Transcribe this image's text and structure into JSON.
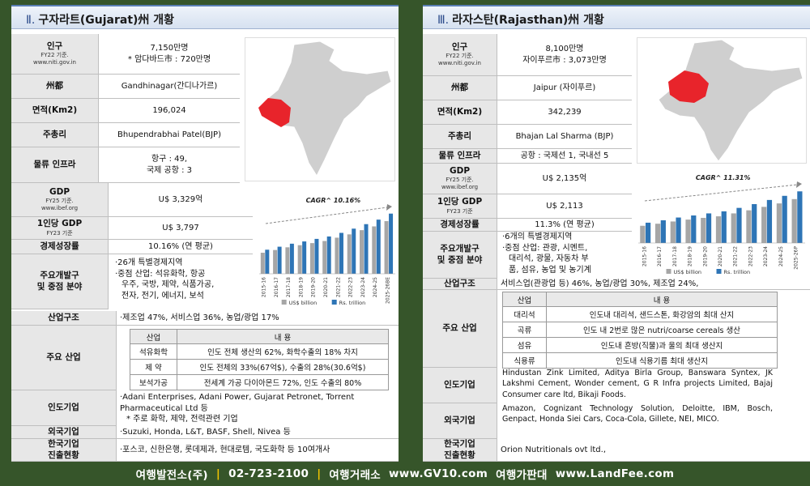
{
  "footer": {
    "company": "여행발전소(주)",
    "phone": "02-723-2100",
    "agency": "여행거래소",
    "site1": "www.GV10.com",
    "market": "여행가판대",
    "site2": "www.LandFee.com"
  },
  "gujarat": {
    "roman": "Ⅱ.",
    "title": "구자라트(Gujarat)州 개황",
    "population": {
      "label": "인구",
      "sub1": "FY22 기준.",
      "sub2": "www.niti.gov.in",
      "line1": "7,150만명",
      "line2": "* 암다바드市 : 720만명"
    },
    "capital": {
      "label": "州都",
      "value": "Gandhinagar(간디나가르)"
    },
    "area": {
      "label": "면적(Km2)",
      "value": "196,024"
    },
    "cm": {
      "label": "주총리",
      "value": "Bhupendrabhai Patel(BJP)"
    },
    "logistics": {
      "label": "물류 인프라",
      "line1": "항구 : 49,",
      "line2": "국제 공항 : 3"
    },
    "gdp": {
      "label": "GDP",
      "sub1": "FY25 기준.",
      "sub2": "www.ibef.org",
      "value": "U$ 3,329억"
    },
    "gdppc": {
      "label": "1인당 GDP",
      "sub": "FY23 기준",
      "value": "U$ 3,797"
    },
    "growth": {
      "label": "경제성장률",
      "value": "10.16% (연 평균)"
    },
    "zones": {
      "label1": "주요개발구",
      "label2": "및 중점 분야",
      "lines": [
        "·26개 특별경제지역",
        "·중점 산업: 석유화학, 항공",
        "우주, 국방, 제약, 식품가공,",
        "전자, 전기, 에너지, 보석"
      ]
    },
    "structure": {
      "label": "산업구조",
      "value": "·제조업 47%, 서비스업 36%, 농업/광업 17%"
    },
    "industry": {
      "label": "주요 산업",
      "head1": "산업",
      "head2": "내 용",
      "rows": [
        {
          "name": "석유화학",
          "desc": "인도 전체 생산의 62%, 화학수출의 18% 차지"
        },
        {
          "name": "제 약",
          "desc": "인도 전체의 33%(67억$), 수출의 28%(30.6억$)"
        },
        {
          "name": "보석가공",
          "desc": "전세계 가공 다이아몬드 72%, 인도 수출의 80%"
        }
      ]
    },
    "indian": {
      "label": "인도기업",
      "line1": "·Adani Enterprises, Adani Power, Gujarat Petronet, Torrent Pharmaceutical Ltd 등",
      "line2": "* 주로 화학, 제약, 전력관련 기업"
    },
    "foreign": {
      "label": "외국기업",
      "value": "·Suzuki, Honda, L&T, BASF, Shell, Nivea 등"
    },
    "korean": {
      "label1": "한국기업",
      "label2": "진출현황",
      "value": "·포스코, 신한은행, 롯데제과, 현대로템, 국도화학 등 10여개사"
    }
  },
  "rajasthan": {
    "roman": "Ⅲ.",
    "title": "라자스탄(Rajasthan)州 개황",
    "population": {
      "label": "인구",
      "sub1": "FY22 기준.",
      "sub2": "www.niti.gov.in",
      "line1": "8,100만명",
      "line2": "자이푸르市 : 3,073만명"
    },
    "capital": {
      "label": "州都",
      "value": "Jaipur (자이푸르)"
    },
    "area": {
      "label": "면적(Km2)",
      "value": "342,239"
    },
    "cm": {
      "label": "주총리",
      "value": "Bhajan Lal Sharma (BJP)"
    },
    "logistics": {
      "label": "물류 인프라",
      "value": "공항 : 국제선 1, 국내선 5"
    },
    "gdp": {
      "label": "GDP",
      "sub1": "FY25 기준.",
      "sub2": "www.ibef.org",
      "value": "U$ 2,135억"
    },
    "gdppc": {
      "label": "1인당 GDP",
      "sub": "FY23 기준",
      "value": "U$ 2,113"
    },
    "growth": {
      "label": "경제성장률",
      "value": "11.3% (연 평균)"
    },
    "zones": {
      "label1": "주요개발구",
      "label2": "및 중점 분야",
      "lines": [
        "·6개의 특별경제지역",
        "·중점 산업: 관광, 시멘트,",
        "대리석, 광물, 자동차 부",
        "품, 섬유, 농업 및 농기계"
      ]
    },
    "structure": {
      "label": "산업구조",
      "value": "서비스업(관광업 등) 46%, 농업/광업 30%, 제조업 24%,"
    },
    "industry": {
      "label": "주요 산업",
      "head1": "산업",
      "head2": "내 용",
      "rows": [
        {
          "name": "대리석",
          "desc": "인도내 대리석, 샌드스톤, 화강암의 최대 산지"
        },
        {
          "name": "곡류",
          "desc": "인도 내 2번로 많은 nutri/coarse cereals 생산"
        },
        {
          "name": "섬유",
          "desc": "인도내 흔방(직물)과 울의 최대 생산지"
        },
        {
          "name": "식용류",
          "desc": "인도내 식용기름 최대 생산지"
        }
      ]
    },
    "indian": {
      "label": "인도기업",
      "value": "Hindustan Zink Limited, Aditya Birla Group, Banswara Syntex, JK Lakshmi Cement, Wonder cement, G R Infra projects Limited, Bajaj Consumer care ltd, Bikaji Foods."
    },
    "foreign": {
      "label": "외국기업",
      "value": "Amazon, Cognizant Technology Solution, Deloitte, IBM, Bosch, Genpact, Honda Siei Cars, Coca-Cola, Gillete, NEI, MICO."
    },
    "korean": {
      "label1": "한국기업",
      "label2": "진출현황",
      "value": "Orion Nutritionals ovt ltd.,"
    }
  },
  "chart_data": [
    {
      "type": "bar",
      "title": "CAGR^ 10.16%",
      "categories": [
        "2015-16",
        "2016-17",
        "2017-18",
        "2018-19",
        "2019-20",
        "2020-21",
        "2021-22",
        "2022-23",
        "2023-24",
        "2024-25",
        "2025-26BE"
      ],
      "series": [
        {
          "name": "US$ billion",
          "values": [
            140,
            158,
            176,
            190,
            204,
            218,
            240,
            262,
            290,
            315,
            350
          ]
        },
        {
          "name": "Rs. trillion",
          "values": [
            160,
            180,
            200,
            215,
            232,
            248,
            272,
            300,
            330,
            360,
            400
          ]
        }
      ],
      "ylim": [
        0,
        420
      ],
      "colors": [
        "#a6a6a6",
        "#2e75b6"
      ]
    },
    {
      "type": "bar",
      "title": "CAGR^ 11.31%",
      "categories": [
        "2015-16",
        "2016-17",
        "2017-18",
        "2018-19",
        "2019-20",
        "2020-21",
        "2021-22",
        "2022-23",
        "2023-24",
        "2024-25",
        "2025-26P"
      ],
      "series": [
        {
          "name": "US$ billion",
          "values": [
            100,
            112,
            125,
            136,
            146,
            155,
            172,
            190,
            210,
            230,
            255
          ]
        },
        {
          "name": "Rs. trillion",
          "values": [
            118,
            132,
            148,
            160,
            172,
            184,
            204,
            226,
            250,
            274,
            300
          ]
        }
      ],
      "ylim": [
        0,
        320
      ],
      "colors": [
        "#a6a6a6",
        "#2e75b6"
      ]
    }
  ],
  "maps": {
    "highlight": "#e8242b",
    "land": "#cfcfcf"
  }
}
